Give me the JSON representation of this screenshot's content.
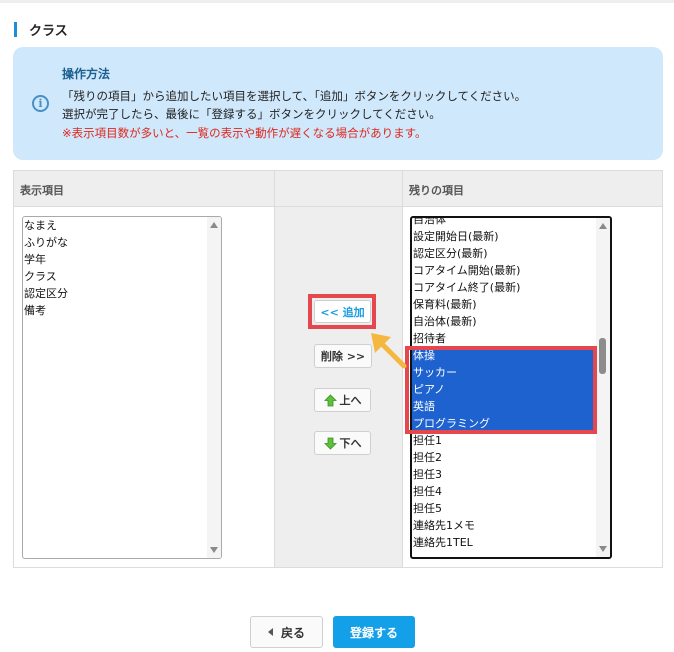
{
  "section": {
    "title": "クラス"
  },
  "info": {
    "title": "操作方法",
    "line1": "「残りの項目」から追加したい項目を選択して、「追加」ボタンをクリックしてください。",
    "line2": "選択が完了したら、最後に「登録する」ボタンをクリックしてください。",
    "warning": "※表示項目数が多いと、一覧の表示や動作が遅くなる場合があります。",
    "icon": "info-icon"
  },
  "columns": {
    "left": "表示項目",
    "middle": "",
    "right": "残りの項目"
  },
  "left_list": [
    "なまえ",
    "ふりがな",
    "学年",
    "クラス",
    "認定区分",
    "備考"
  ],
  "right_list": [
    {
      "label": "自治体",
      "selected": false
    },
    {
      "label": "設定開始日(最新)",
      "selected": false
    },
    {
      "label": "認定区分(最新)",
      "selected": false
    },
    {
      "label": "コアタイム開始(最新)",
      "selected": false
    },
    {
      "label": "コアタイム終了(最新)",
      "selected": false
    },
    {
      "label": "保育料(最新)",
      "selected": false
    },
    {
      "label": "自治体(最新)",
      "selected": false
    },
    {
      "label": "招待者",
      "selected": false
    },
    {
      "label": "体操",
      "selected": true
    },
    {
      "label": "サッカー",
      "selected": true
    },
    {
      "label": "ピアノ",
      "selected": true
    },
    {
      "label": "英語",
      "selected": true
    },
    {
      "label": "プログラミング",
      "selected": true
    },
    {
      "label": "担任1",
      "selected": false
    },
    {
      "label": "担任2",
      "selected": false
    },
    {
      "label": "担任3",
      "selected": false
    },
    {
      "label": "担任4",
      "selected": false
    },
    {
      "label": "担任5",
      "selected": false
    },
    {
      "label": "連絡先1メモ",
      "selected": false
    },
    {
      "label": "連絡先1TEL",
      "selected": false
    }
  ],
  "buttons": {
    "add": "<< 追加",
    "delete": "削除 >>",
    "up": "上へ",
    "down": "下へ",
    "back": "戻る",
    "register": "登録する"
  },
  "colors": {
    "accent": "#13a0e8",
    "highlight": "#e5474f",
    "selection": "#1e62d0",
    "arrow": "#f4b740"
  }
}
